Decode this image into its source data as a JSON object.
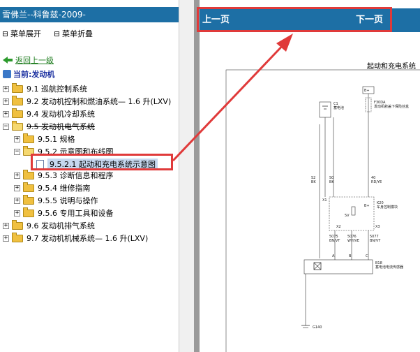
{
  "app_title": "雪佛兰--科鲁兹-2009-",
  "menu_ops": {
    "expand": "菜单展开",
    "collapse": "菜单折叠"
  },
  "back_link": "返回上一级",
  "current": "当前:发动机",
  "tree": [
    {
      "label": "9.1 巡航控制系统"
    },
    {
      "label": "9.2 发动机控制和燃油系统— 1.6 升(LXV)"
    },
    {
      "label": "9.4 发动机冷却系统"
    },
    {
      "label": "9.5 发动机电气系统"
    },
    {
      "label": "9.5.1 规格"
    },
    {
      "label": "9.5.2 示意图和布线图"
    },
    {
      "label": "9.5.2.1 起动和充电系统示意图"
    },
    {
      "label": "9.5.3 诊断信息和程序"
    },
    {
      "label": "9.5.4 维修指南"
    },
    {
      "label": "9.5.5 说明与操作"
    },
    {
      "label": "9.5.6 专用工具和设备"
    },
    {
      "label": "9.6 发动机排气系统"
    },
    {
      "label": "9.7 发动机机械系统— 1.6 升(LXV)"
    }
  ],
  "nav": {
    "prev": "上一页",
    "next": "下一页"
  },
  "diagram": {
    "title": "起动和充电系统",
    "labels": {
      "c1": "C1",
      "c1b": "蓄电池",
      "bplus": "B+",
      "bplus2": "B+",
      "f": "F30DA",
      "fb": "发动机舱盖下保险丝盒",
      "w1": "S2",
      "w1b": "BK",
      "w2": "S0",
      "w2b": "BK",
      "w3": "40",
      "w3b": "RD/YE",
      "k20": "K20",
      "k20b": "车身控制模块",
      "v5": "5V",
      "x1": "X1",
      "x2": "X2",
      "x3": "X3",
      "w4": "5075",
      "w4b": "BN/VT",
      "w5": "5076",
      "w5b": "WH/VE",
      "w6": "5077",
      "w6b": "BN/VT",
      "b18": "B18",
      "b18b": "蓄电池电流传感器",
      "pa": "A",
      "pb": "B",
      "pc": "C",
      "g": "G140"
    }
  },
  "colors": {
    "title_bar": "#1d6fa5",
    "highlight": "#e03a3a",
    "folder": "#f0c040"
  }
}
